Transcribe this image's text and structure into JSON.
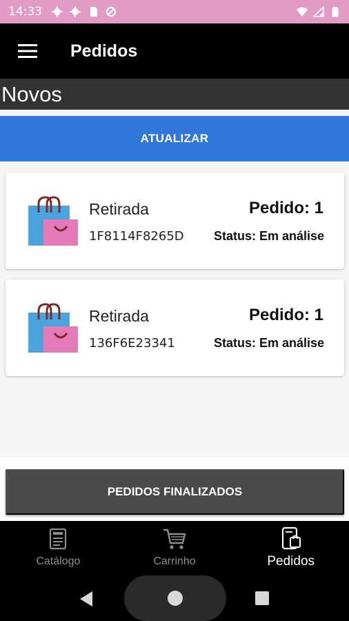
{
  "status_bar": {
    "time": "14:33",
    "icons_left": [
      "gear-icon",
      "gear-icon",
      "sd-card-icon",
      "no-sync-icon"
    ],
    "icons_right": [
      "wifi-icon",
      "signal-icon",
      "battery-icon"
    ]
  },
  "app_bar": {
    "title": "Pedidos"
  },
  "section": {
    "title": "Novos"
  },
  "refresh_button": {
    "label": "ATUALIZAR"
  },
  "orders": [
    {
      "type": "Retirada",
      "code": "1F8114F8265D",
      "number": "Pedido: 1",
      "status": "Status: Em análise"
    },
    {
      "type": "Retirada",
      "code": "136F6E23341",
      "number": "Pedido: 1",
      "status": "Status: Em análise"
    }
  ],
  "finished_button": {
    "label": "PEDIDOS FINALIZADOS"
  },
  "bottom_nav": [
    {
      "label": "Catálogo",
      "icon": "menu-card-icon",
      "active": false
    },
    {
      "label": "Carrinho",
      "icon": "cart-icon",
      "active": false
    },
    {
      "label": "Pedidos",
      "icon": "orders-icon",
      "active": true
    }
  ],
  "colors": {
    "status_bar": "#e29bc4",
    "accent": "#2f77d8",
    "dark": "#000000"
  }
}
